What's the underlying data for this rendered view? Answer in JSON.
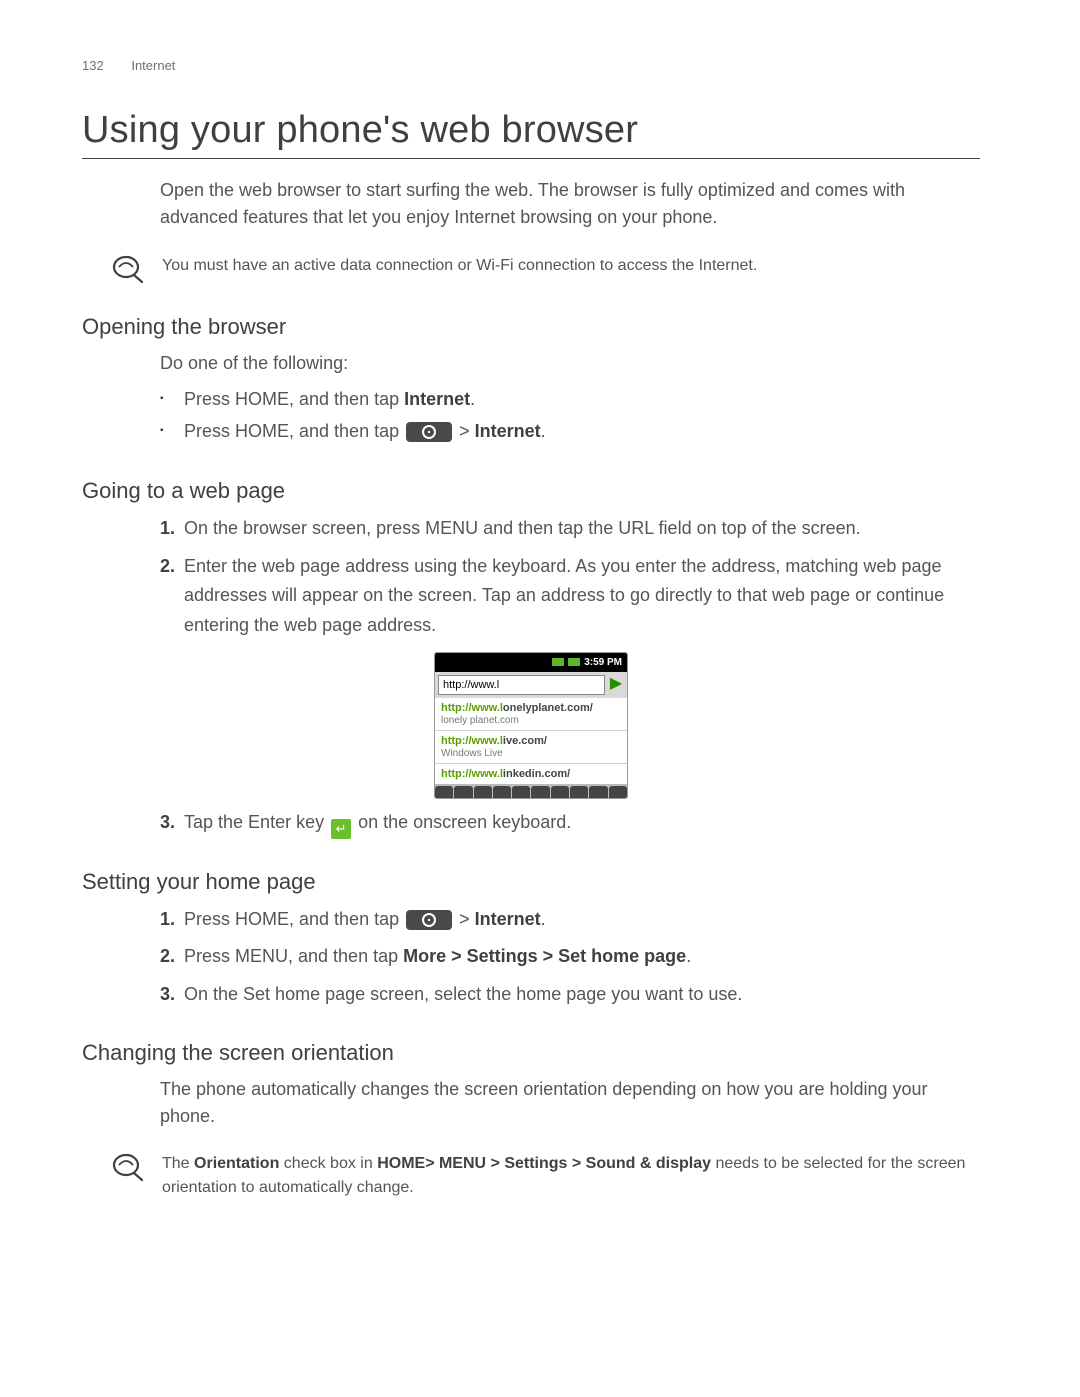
{
  "header": {
    "page_number": "132",
    "section": "Internet"
  },
  "title": "Using your phone's web browser",
  "intro": "Open the web browser to start surfing the web. The browser is fully optimized and comes with advanced features that let you enjoy Internet browsing on your phone.",
  "note1": "You must have an active data connection or Wi-Fi connection to access the Internet.",
  "opening": {
    "heading": "Opening the browser",
    "lead": "Do one of the following:",
    "item1_a": "Press HOME, and then tap ",
    "item1_b": "Internet",
    "item1_c": ".",
    "item2_a": "Press HOME, and then tap ",
    "item2_gt": " > ",
    "item2_b": "Internet",
    "item2_c": "."
  },
  "going": {
    "heading": "Going to a web page",
    "step1": "On the browser screen, press MENU and then tap the URL field on top of the screen.",
    "step2": "Enter the web page address using the keyboard. As you enter the address, matching web page addresses will appear on the screen. Tap an address to go directly to that web page or continue entering the web page address.",
    "step3_a": "Tap the Enter key ",
    "step3_b": " on the onscreen keyboard."
  },
  "phone": {
    "time": "3:59 PM",
    "url_value": "http://www.l",
    "suggestions": [
      {
        "match": "http://www.l",
        "rest": "onelyplanet.com/",
        "sub": "lonely planet.com"
      },
      {
        "match": "http://www.l",
        "rest": "ive.com/",
        "sub": "Windows Live"
      },
      {
        "match": "http://www.l",
        "rest": "inkedin.com/",
        "sub": ""
      }
    ]
  },
  "homepage": {
    "heading": "Setting your home page",
    "step1_a": "Press HOME, and then tap ",
    "step1_gt": " > ",
    "step1_b": "Internet",
    "step1_c": ".",
    "step2_a": "Press MENU, and then tap ",
    "step2_b": "More > Settings > Set home page",
    "step2_c": ".",
    "step3": "On the Set home page screen, select the home page you want to use."
  },
  "orientation": {
    "heading": "Changing the screen orientation",
    "body": "The phone automatically changes the screen orientation depending on how you are holding your phone.",
    "note_a": "The ",
    "note_b": "Orientation",
    "note_c": " check box in ",
    "note_d": "HOME> MENU > Settings > Sound & display",
    "note_e": " needs to be selected for the screen orientation to automatically change."
  }
}
